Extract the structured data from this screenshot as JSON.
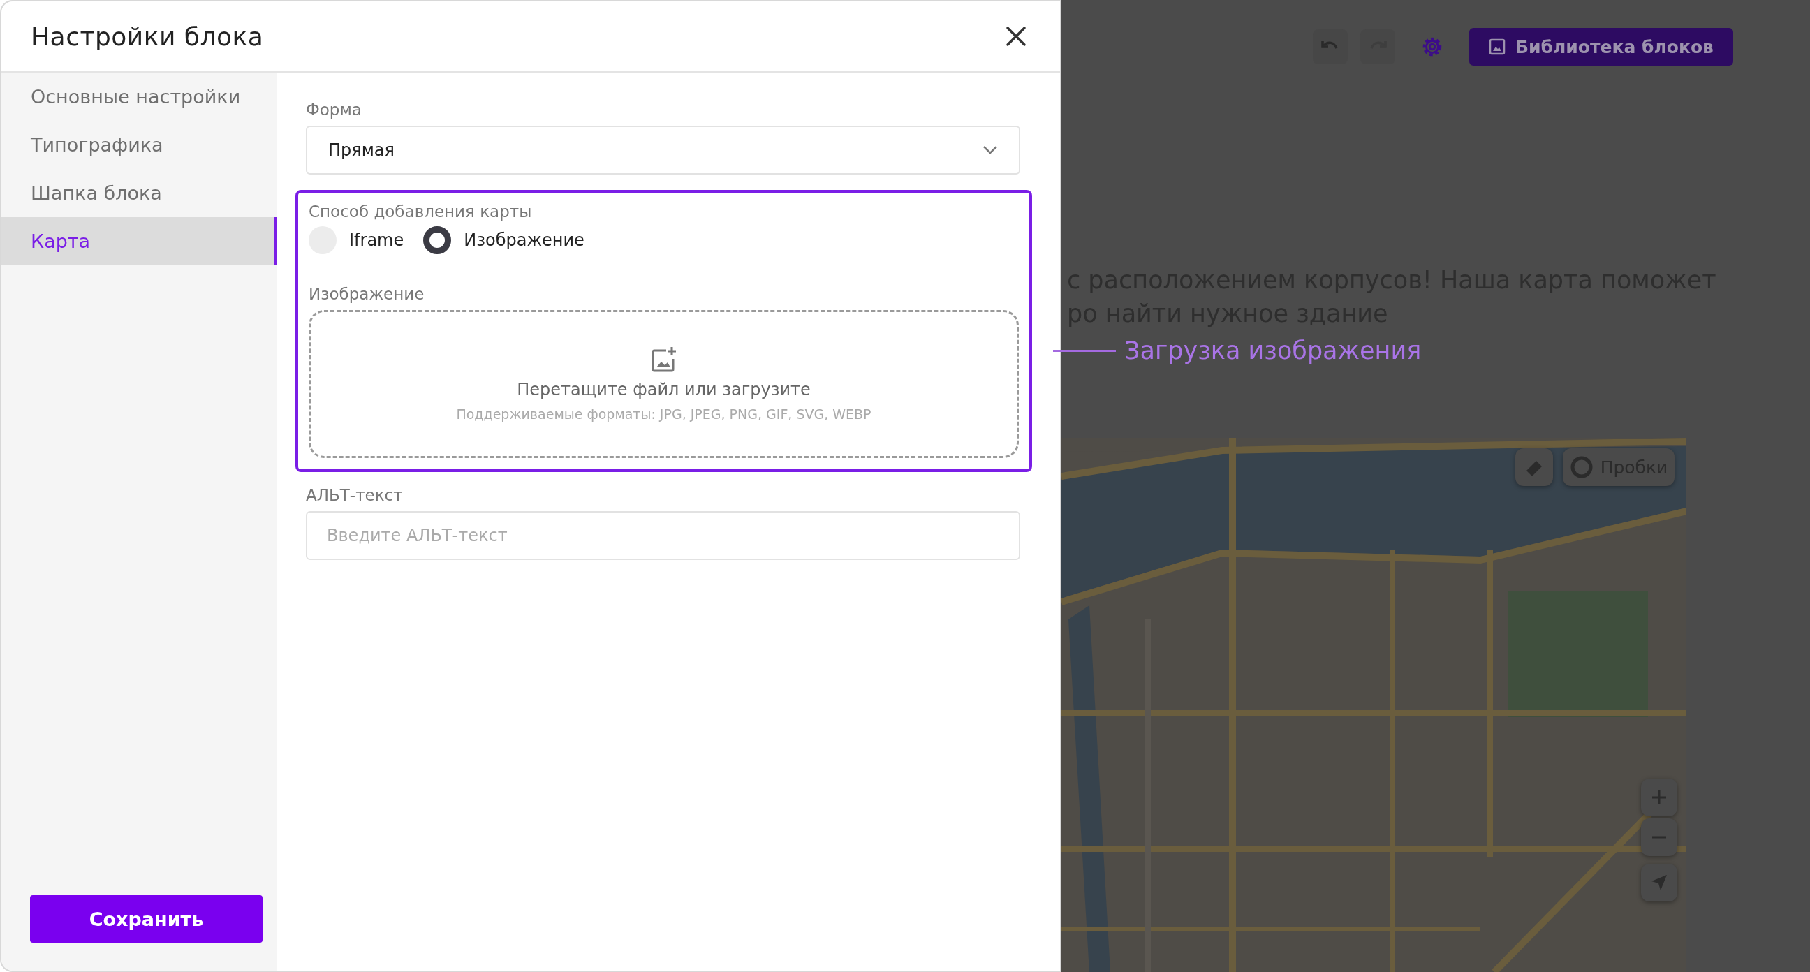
{
  "modal": {
    "title": "Настройки блока"
  },
  "sidebar": {
    "items": [
      {
        "label": "Основные настройки",
        "selected": false
      },
      {
        "label": "Типографика",
        "selected": false
      },
      {
        "label": "Шапка блока",
        "selected": false
      },
      {
        "label": "Карта",
        "selected": true
      }
    ]
  },
  "save_button": "Сохранить",
  "form": {
    "shape": {
      "label": "Форма",
      "value": "Прямая"
    },
    "map_source": {
      "label": "Способ добавления карты",
      "highlighted": true,
      "options": [
        {
          "label": "Iframe",
          "selected": false
        },
        {
          "label": "Изображение",
          "selected": true
        }
      ]
    },
    "image": {
      "label": "Изображение",
      "dropzone_text": "Перетащите файл или загрузите",
      "dropzone_hint": "Поддерживаемые форматы: JPG, JPEG, PNG, GIF, SVG, WEBP"
    },
    "alt_text": {
      "label": "АЛЬТ-текст",
      "placeholder": "Введите АЛЬТ-текст"
    }
  },
  "page": {
    "library_button": "Библиотека блоков",
    "paragraph": [
      "с расположением корпусов! Наша карта поможет",
      "ро найти нужное здание"
    ],
    "map": {
      "kind": "picture",
      "traffic_button": "Пробки"
    }
  },
  "annotation": {
    "text": "Загрузка изображения"
  }
}
